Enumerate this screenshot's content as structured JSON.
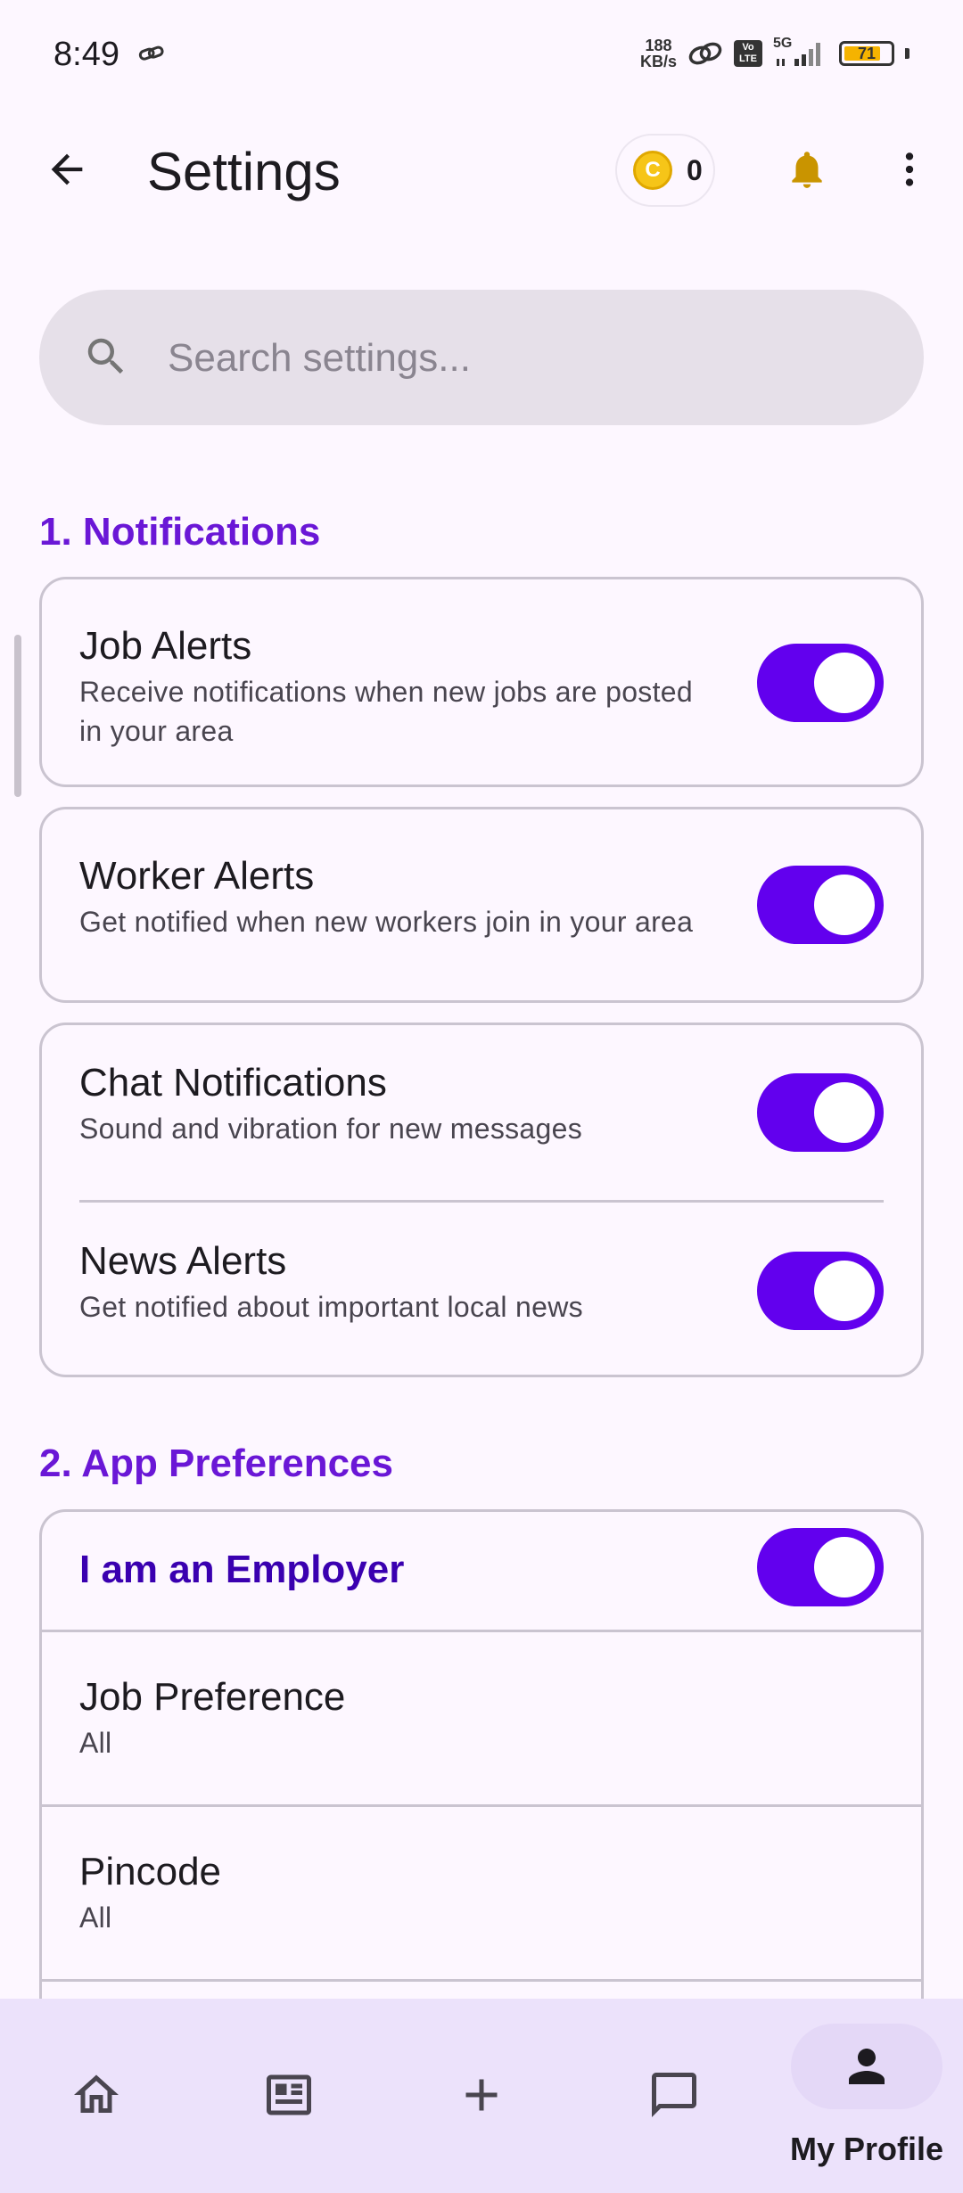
{
  "status": {
    "time": "8:49",
    "net_speed_top": "188",
    "net_speed_bottom": "KB/s",
    "volte_top": "Vo",
    "volte_bottom": "LTE",
    "network": "5G",
    "battery": "71"
  },
  "appbar": {
    "title": "Settings",
    "coins": "0",
    "coin_symbol": "C"
  },
  "search": {
    "placeholder": "Search settings..."
  },
  "sections": {
    "notifications": {
      "title": "1. Notifications",
      "job_alerts": {
        "title": "Job Alerts",
        "subtitle_line1": "Receive notifications when new jobs are posted",
        "subtitle_line2": "in your area",
        "enabled": true
      },
      "worker_alerts": {
        "title": "Worker Alerts",
        "subtitle": "Get notified when new workers join in your area",
        "enabled": true
      },
      "chat_notifications": {
        "title": "Chat Notifications",
        "subtitle": "Sound and vibration for new messages",
        "enabled": true
      },
      "news_alerts": {
        "title": "News Alerts",
        "subtitle": "Get notified about important local news",
        "enabled": true
      }
    },
    "app_preferences": {
      "title": "2. App Preferences",
      "employer": {
        "label": "I am an Employer",
        "enabled": true
      },
      "job_preference": {
        "title": "Job Preference",
        "value": "All"
      },
      "pincode": {
        "title": "Pincode",
        "value": "All"
      }
    }
  },
  "bottom_nav": {
    "items": [
      {
        "icon": "home-icon"
      },
      {
        "icon": "news-icon"
      },
      {
        "icon": "add-icon"
      },
      {
        "icon": "chat-icon"
      },
      {
        "icon": "person-icon",
        "label": "My Profile",
        "selected": true
      }
    ]
  },
  "colors": {
    "accent": "#6200ee",
    "section_title": "#6a17d6",
    "background": "#fdf7ff",
    "nav_background": "#ece2fb"
  }
}
